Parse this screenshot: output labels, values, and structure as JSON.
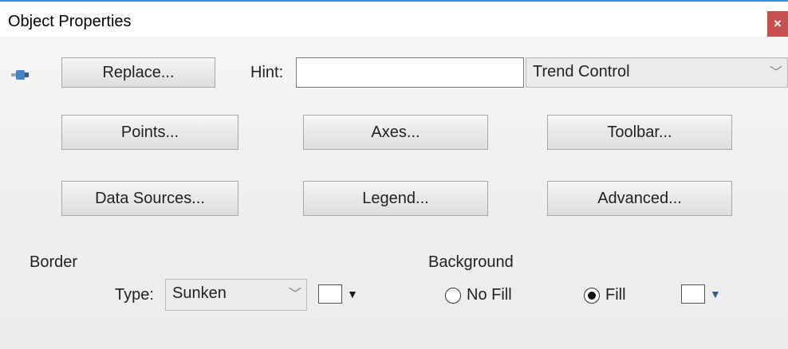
{
  "window": {
    "title": "Object Properties",
    "close_glyph": "×"
  },
  "toolbar": {
    "pin_icon": "pin-icon",
    "replace_label": "Replace...",
    "hint_label": "Hint:",
    "hint_value": "",
    "object_type": "Trend Control"
  },
  "buttons": {
    "points": "Points...",
    "axes": "Axes...",
    "toolbar": "Toolbar...",
    "data_sources": "Data Sources...",
    "legend": "Legend...",
    "advanced": "Advanced..."
  },
  "border": {
    "heading": "Border",
    "type_label": "Type:",
    "type_value": "Sunken",
    "color": "#ffffff"
  },
  "background": {
    "heading": "Background",
    "no_fill_label": "No Fill",
    "fill_label": "Fill",
    "selected": "Fill",
    "color": "#ffffff"
  },
  "colors": {
    "accent": "#3c8fd8",
    "close": "#c74f4f",
    "pin": "#4a82c6"
  }
}
